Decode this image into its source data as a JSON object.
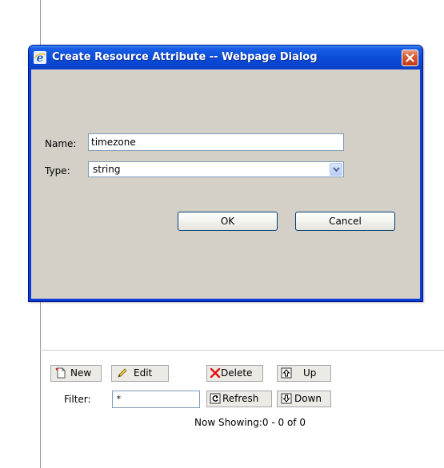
{
  "dialog": {
    "title": "Create Resource Attribute -- Webpage Dialog",
    "name_label": "Name:",
    "name_value": "timezone",
    "type_label": "Type:",
    "type_value": "string",
    "ok_label": "OK",
    "cancel_label": "Cancel"
  },
  "toolbar": {
    "new_label": "New",
    "edit_label": "Edit",
    "delete_label": "Delete",
    "up_label": "Up",
    "filter_label": "Filter:",
    "filter_value": "*",
    "refresh_label": "Refresh",
    "down_label": "Down",
    "now_showing": "Now Showing:0 - 0 of 0"
  },
  "colors": {
    "titlebar": "#0a46d0",
    "client": "#d4d0c8",
    "close_button": "#c43b17",
    "delete_icon": "#e01010"
  },
  "icons": {
    "title": "ie-icon",
    "close": "close-icon",
    "select": "chevron-down-icon",
    "new": "new-document-icon",
    "edit": "pencil-icon",
    "delete": "x-icon",
    "up": "arrow-up-icon",
    "refresh": "refresh-icon",
    "down": "arrow-down-icon"
  }
}
